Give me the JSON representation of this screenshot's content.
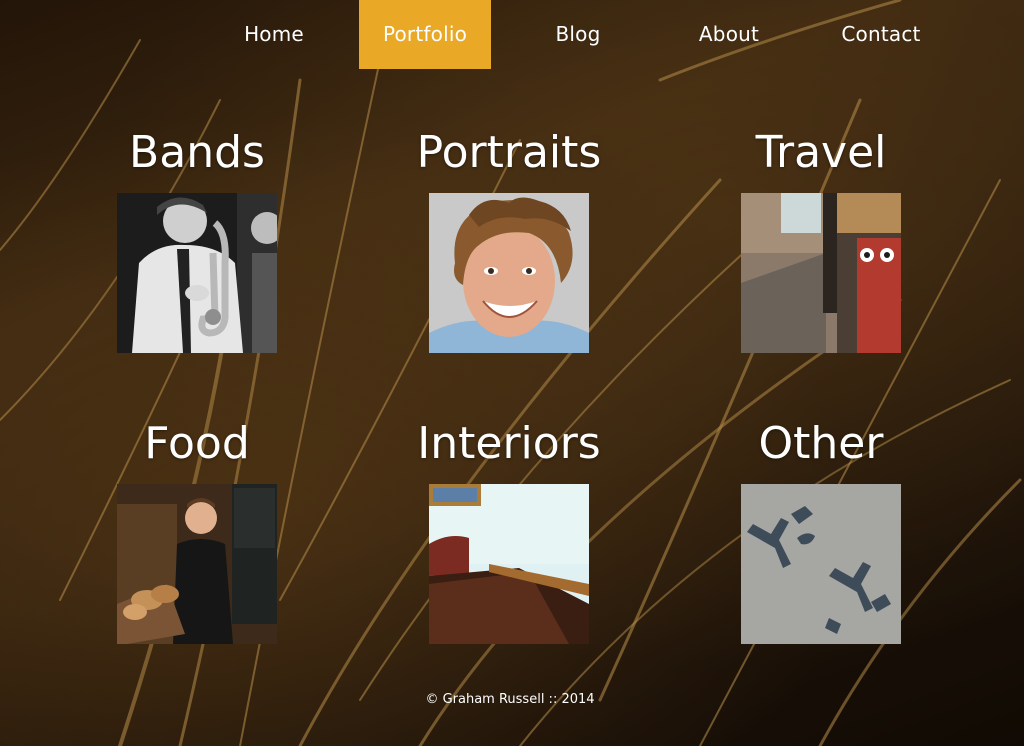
{
  "nav": {
    "items": [
      {
        "label": "Home",
        "active": false
      },
      {
        "label": "Portfolio",
        "active": true
      },
      {
        "label": "Blog",
        "active": false
      },
      {
        "label": "About",
        "active": false
      },
      {
        "label": "Contact",
        "active": false
      }
    ],
    "active_color": "#e9a825"
  },
  "categories": [
    {
      "title": "Bands",
      "thumbnail": "saxophone-player-photo"
    },
    {
      "title": "Portraits",
      "thumbnail": "smiling-man-photo"
    },
    {
      "title": "Travel",
      "thumbnail": "street-owl-sign-photo"
    },
    {
      "title": "Food",
      "thumbnail": "baker-with-bread-photo"
    },
    {
      "title": "Interiors",
      "thumbnail": "dining-table-photo"
    },
    {
      "title": "Other",
      "thumbnail": "yes-stencil-pavement-photo"
    }
  ],
  "footer": {
    "text": "© Graham Russell :: 2014"
  }
}
